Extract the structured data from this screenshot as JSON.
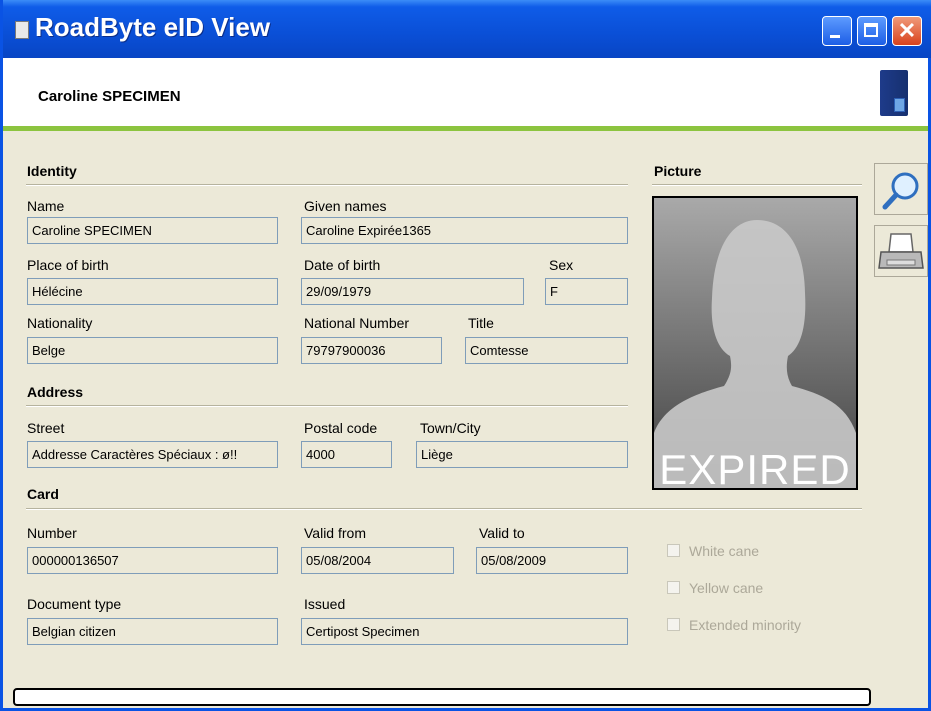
{
  "window": {
    "title": "RoadByte eID View"
  },
  "header": {
    "holder_name": "Caroline SPECIMEN"
  },
  "identity": {
    "section": "Identity",
    "name_label": "Name",
    "name": "Caroline SPECIMEN",
    "given_label": "Given names",
    "given": "Caroline Expirée1365",
    "pob_label": "Place of birth",
    "pob": "Hélécine",
    "dob_label": "Date of birth",
    "dob": "29/09/1979",
    "sex_label": "Sex",
    "sex": "F",
    "nat_label": "Nationality",
    "nat": "Belge",
    "natnum_label": "National Number",
    "natnum": "79797900036",
    "title_label": "Title",
    "title": "Comtesse"
  },
  "address": {
    "section": "Address",
    "street_label": "Street",
    "street": "Addresse Caractères Spéciaux : ø!!",
    "postal_label": "Postal code",
    "postal": "4000",
    "town_label": "Town/City",
    "town": "Liège"
  },
  "card": {
    "section": "Card",
    "number_label": "Number",
    "number": "000000136507",
    "from_label": "Valid from",
    "from": "05/08/2004",
    "to_label": "Valid to",
    "to": "05/08/2009",
    "doctype_label": "Document type",
    "doctype": "Belgian citizen",
    "issued_label": "Issued",
    "issued": "Certipost Specimen"
  },
  "picture": {
    "section": "Picture",
    "overlay": "EXPIRED"
  },
  "options": {
    "white_cane": "White cane",
    "yellow_cane": "Yellow cane",
    "ext_minority": "Extended minority"
  },
  "icons": {
    "zoom": "magnifier-icon",
    "print": "printer-icon",
    "card": "eid-card-icon"
  },
  "colors": {
    "titlebar": "#0a4fd6",
    "accent_bar": "#8cc43f",
    "field_border": "#7f9db9"
  }
}
